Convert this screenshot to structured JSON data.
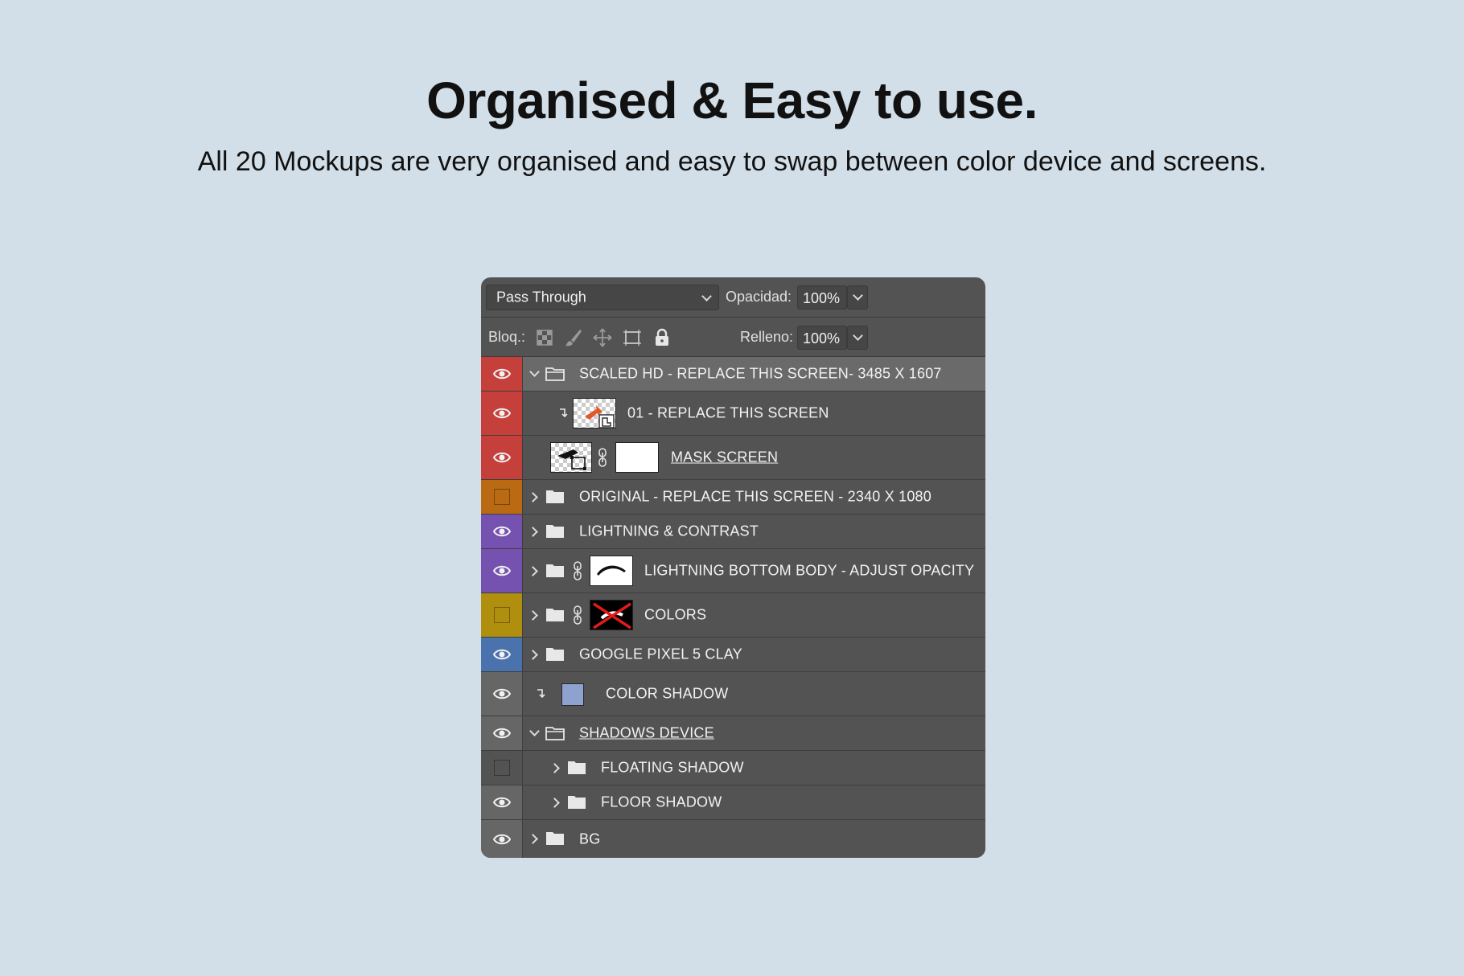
{
  "heading": "Organised & Easy to use.",
  "subheading": "All 20 Mockups are very organised and easy to swap between color device and screens.",
  "panel": {
    "blend_mode": "Pass Through",
    "opacity_label": "Opacidad:",
    "opacity_value": "100%",
    "lock_label": "Bloq.:",
    "fill_label": "Relleno:",
    "fill_value": "100%",
    "lock_icons": [
      "lock-transparent-icon",
      "lock-paint-icon",
      "lock-move-icon",
      "lock-artboard-icon",
      "lock-all-icon"
    ]
  },
  "colors": {
    "red": "#c5403b",
    "orange": "#b96a12",
    "violet": "#7551b0",
    "yellow": "#b08f0e",
    "blue": "#4a73ad",
    "gray": "#666666",
    "color_shadow_swatch": "#8fa2cf"
  },
  "layers": [
    {
      "name": "SCALED HD - REPLACE THIS SCREEN- 3485 X 1607",
      "color": "red",
      "visible": true,
      "type": "group",
      "expanded": true,
      "selected": true
    },
    {
      "name": "01 - REPLACE THIS SCREEN",
      "color": "red",
      "visible": true,
      "type": "smart-object",
      "clipped": true
    },
    {
      "name": "MASK SCREEN",
      "color": "red",
      "visible": true,
      "type": "masked-layer",
      "underlined": true
    },
    {
      "name": "ORIGINAL - REPLACE THIS SCREEN - 2340 X 1080",
      "color": "orange",
      "visible": false,
      "type": "group",
      "expanded": false
    },
    {
      "name": "LIGHTNING & CONTRAST",
      "color": "violet",
      "visible": true,
      "type": "group",
      "expanded": false
    },
    {
      "name": "LIGHTNING BOTTOM BODY - ADJUST OPACITY",
      "color": "violet",
      "visible": true,
      "type": "group-with-mask",
      "expanded": false
    },
    {
      "name": "COLORS",
      "color": "yellow",
      "visible": false,
      "type": "group-with-mask",
      "expanded": false
    },
    {
      "name": "GOOGLE PIXEL 5 CLAY",
      "color": "blue",
      "visible": true,
      "type": "group",
      "expanded": false
    },
    {
      "name": "COLOR SHADOW",
      "color": "gray",
      "visible": true,
      "type": "fill",
      "clipped": true
    },
    {
      "name": "SHADOWS DEVICE",
      "color": "gray",
      "visible": true,
      "type": "group",
      "expanded": true,
      "underlined": true
    },
    {
      "name": "FLOATING SHADOW",
      "color": "gray",
      "visible": false,
      "type": "group",
      "expanded": false,
      "nested": true
    },
    {
      "name": "FLOOR SHADOW",
      "color": "gray",
      "visible": true,
      "type": "group",
      "expanded": false,
      "nested": true
    },
    {
      "name": "BG",
      "color": "gray",
      "visible": true,
      "type": "group",
      "expanded": false
    }
  ]
}
